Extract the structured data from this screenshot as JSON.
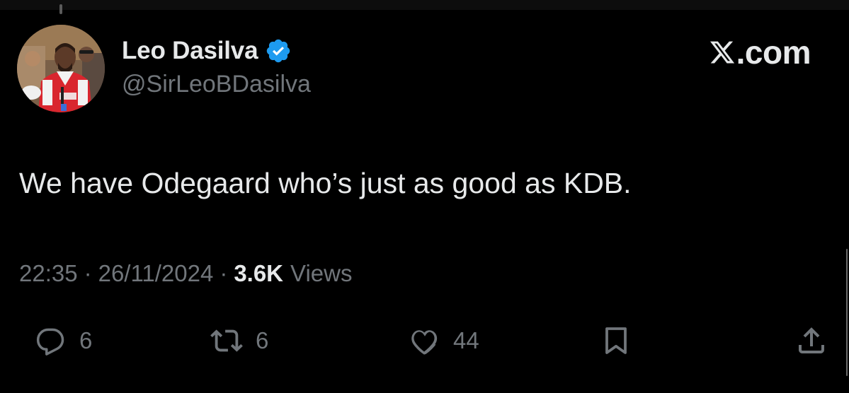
{
  "author": {
    "display_name": "Leo Dasilva",
    "handle": "@SirLeoBDasilva",
    "verified_icon": "verified-badge-icon",
    "avatar": "profile-photo"
  },
  "brand": {
    "site": ".com",
    "logo_icon": "x-logo-icon"
  },
  "tweet": {
    "text": "We have Odegaard who’s just as good as KDB."
  },
  "meta": {
    "time": "22:35",
    "separator": "·",
    "date": "26/11/2024",
    "views_count": "3.6K",
    "views_label": "Views"
  },
  "actions": {
    "reply": {
      "count": "6",
      "icon": "reply-icon"
    },
    "retweet": {
      "count": "6",
      "icon": "retweet-icon"
    },
    "like": {
      "count": "44",
      "icon": "heart-icon"
    },
    "bookmark": {
      "icon": "bookmark-icon"
    },
    "share": {
      "icon": "share-icon"
    }
  },
  "colors": {
    "background": "#000000",
    "primary_text": "#e7e9ea",
    "secondary_text": "#71767b",
    "verified_blue": "#1d9bf0"
  }
}
